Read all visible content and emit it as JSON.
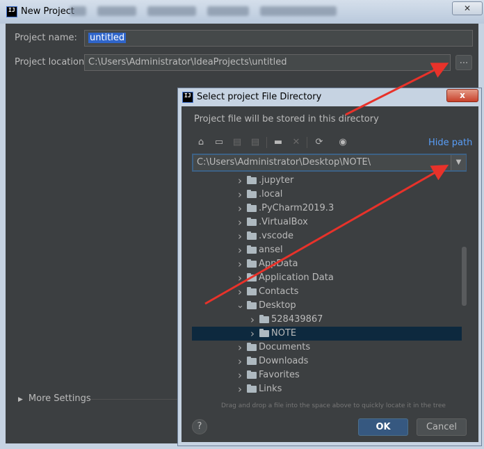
{
  "outer": {
    "title": "New Project",
    "close_icon": "close-icon",
    "project_name_label": "Project name:",
    "project_name_value": "untitled",
    "project_location_label": "Project location:",
    "project_location_value": "C:\\Users\\Administrator\\IdeaProjects\\untitled",
    "browse_label": "...",
    "more_settings_label": "More Settings"
  },
  "dialog": {
    "title": "Select project File Directory",
    "close_label": "x",
    "description": "Project file will be stored in this directory",
    "hide_path_label": "Hide path",
    "toolbar_icons": [
      "home-icon",
      "desktop-icon",
      "project-icon",
      "module-icon",
      "new-folder-icon",
      "delete-icon",
      "refresh-icon",
      "show-hidden-icon"
    ],
    "path_value": "C:\\Users\\Administrator\\Desktop\\NOTE\\",
    "tree": [
      {
        "label": ".jupyter",
        "expanded": false
      },
      {
        "label": ".local",
        "expanded": false
      },
      {
        "label": ".PyCharm2019.3",
        "expanded": false
      },
      {
        "label": ".VirtualBox",
        "expanded": false
      },
      {
        "label": ".vscode",
        "expanded": false
      },
      {
        "label": "ansel",
        "expanded": false
      },
      {
        "label": "AppData",
        "expanded": false
      },
      {
        "label": "Application Data",
        "expanded": false
      },
      {
        "label": "Contacts",
        "expanded": false
      },
      {
        "label": "Desktop",
        "expanded": true
      },
      {
        "label": "528439867",
        "expanded": false
      },
      {
        "label": "NOTE",
        "expanded": false,
        "selected": true
      },
      {
        "label": "Documents",
        "expanded": false
      },
      {
        "label": "Downloads",
        "expanded": false
      },
      {
        "label": "Favorites",
        "expanded": false
      },
      {
        "label": "Links",
        "expanded": false
      }
    ],
    "drag_hint": "Drag and drop a file into the space above to quickly locate it in the tree",
    "help_label": "?",
    "ok_label": "OK",
    "cancel_label": "Cancel"
  },
  "colors": {
    "background": "#3c3f41",
    "selection": "#0d293e",
    "link": "#589df6",
    "ok_button": "#365880",
    "arrow": "#e8322a"
  }
}
